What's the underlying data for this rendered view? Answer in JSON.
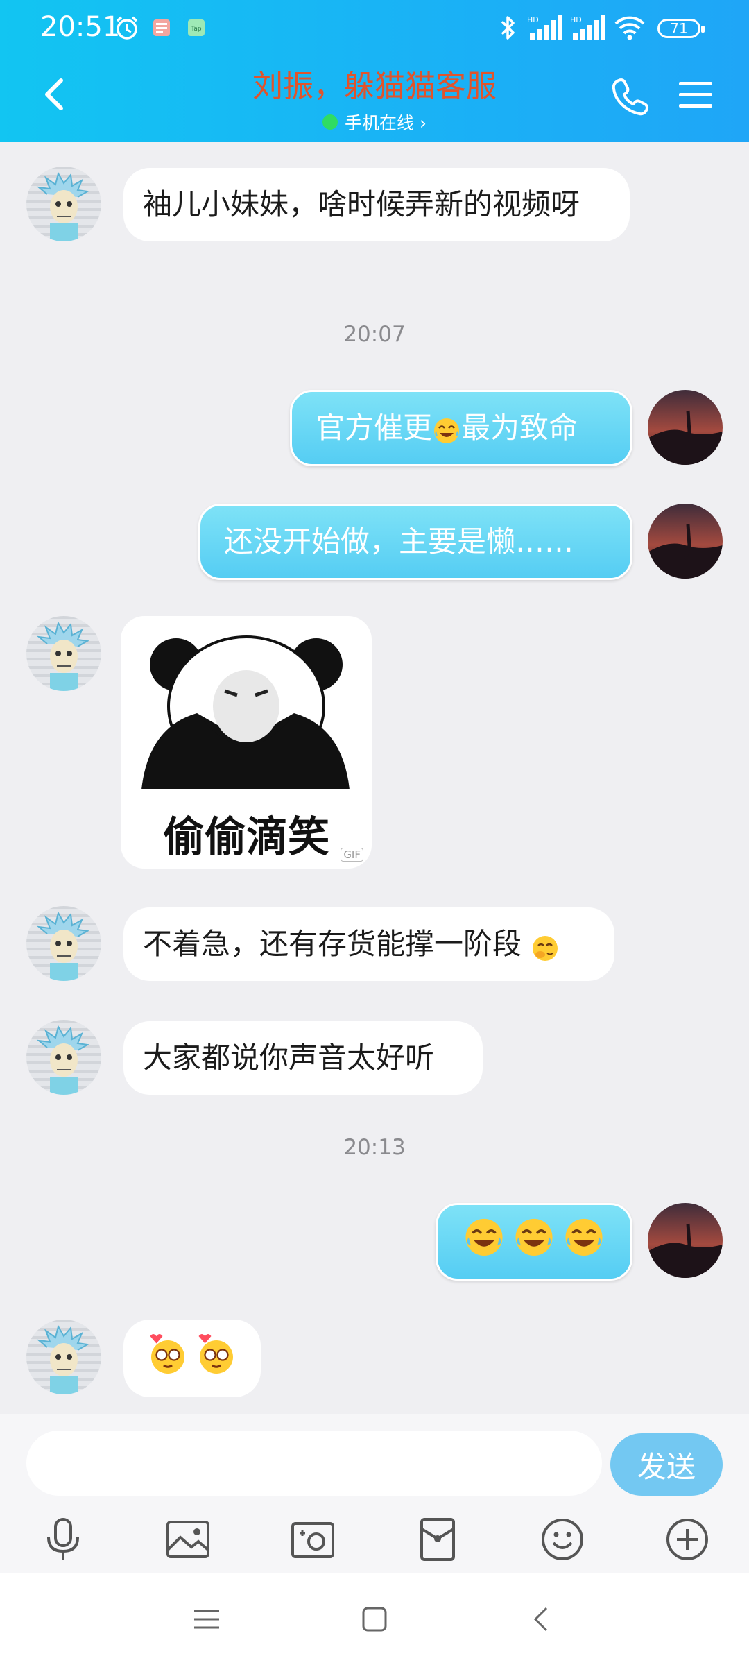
{
  "status_bar": {
    "time": "20:51",
    "battery": "71"
  },
  "header": {
    "title": "刘振，躲猫猫客服",
    "subtitle": "手机在线 ›"
  },
  "messages": [
    {
      "text": "袖儿小妹妹，啥时候弄新的视频呀"
    },
    {
      "timestamp": "20:07"
    },
    {
      "text_before": "官方催更",
      "text_after": "最为致命"
    },
    {
      "text": "还没开始做，主要是懒……"
    },
    {
      "sticker_caption": "偷偷滴笑",
      "gif_badge": "GIF"
    },
    {
      "text": "不着急，还有存货能撑一阶段"
    },
    {
      "text": "大家都说你声音太好听"
    },
    {
      "timestamp": "20:13"
    },
    {
      "emoji_icons": [
        "tears-of-joy-emoji",
        "tears-of-joy-emoji",
        "tears-of-joy-emoji"
      ]
    },
    {
      "emoji_icons": [
        "heart-eyes-emoji",
        "heart-eyes-emoji"
      ]
    }
  ],
  "input": {
    "placeholder": "",
    "send_label": "发送"
  },
  "toolbar": [
    "microphone-icon",
    "image-icon",
    "camera-icon",
    "red-packet-icon",
    "emoji-icon",
    "plus-icon"
  ],
  "colors": {
    "header_start": "#12c5f2",
    "header_end": "#1fa6f7",
    "title": "#e0542c",
    "send": "#73c8f2",
    "bubble_right": "#55cdf3",
    "background": "#efeff2"
  }
}
